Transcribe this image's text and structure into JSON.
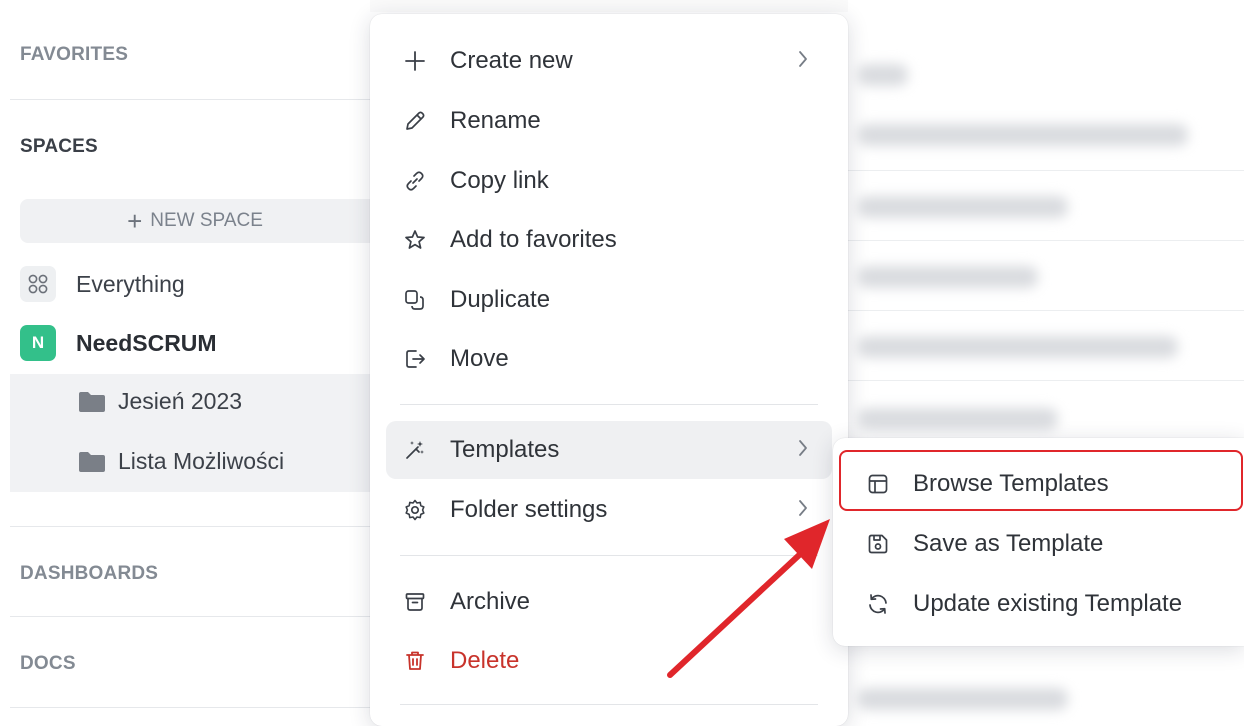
{
  "sidebar": {
    "favorites_title": "FAVORITES",
    "spaces_title": "SPACES",
    "new_space_label": "NEW SPACE",
    "everything_label": "Everything",
    "space": {
      "badge": "N",
      "name": "NeedSCRUM",
      "badge_color": "#33c08a"
    },
    "folders": [
      "Jesień 2023",
      "Lista Możliwości"
    ],
    "dashboards_title": "DASHBOARDS",
    "docs_title": "DOCS"
  },
  "menu": {
    "create_new": "Create new",
    "rename": "Rename",
    "copy_link": "Copy link",
    "add_to_favorites": "Add to favorites",
    "duplicate": "Duplicate",
    "move": "Move",
    "templates": "Templates",
    "folder_settings": "Folder settings",
    "archive": "Archive",
    "delete": "Delete"
  },
  "submenu": {
    "browse_templates": "Browse Templates",
    "save_as_template": "Save as Template",
    "update_existing_template": "Update existing Template"
  },
  "colors": {
    "annotation_red": "#e0262b",
    "danger_red": "#c8332b"
  },
  "icons": {
    "create_new": "plus-icon",
    "rename": "pencil-icon",
    "copy_link": "link-icon",
    "add_to_favorites": "star-icon",
    "duplicate": "duplicate-icon",
    "move": "move-icon",
    "templates": "magic-wand-icon",
    "folder_settings": "gear-icon",
    "archive": "archive-icon",
    "delete": "trash-icon",
    "browse_templates": "layout-icon",
    "save_as_template": "save-icon",
    "update_existing_template": "refresh-icon"
  }
}
